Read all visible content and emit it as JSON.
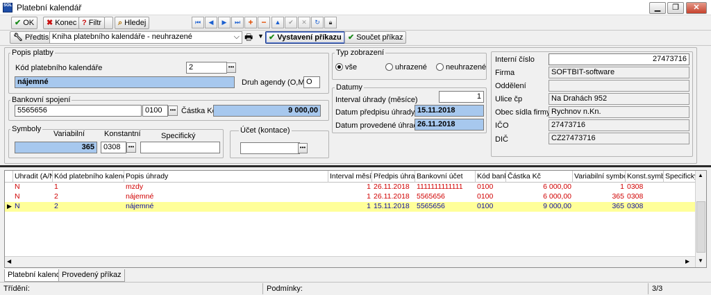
{
  "window": {
    "title": "Platební kalendář",
    "app_icon_text": "SOL"
  },
  "colors": {
    "blue_field": "#a7c8ee",
    "selected_row": "#ffff99",
    "red_text": "#d00000"
  },
  "toolbar": {
    "ok": "OK",
    "konec": "Konec",
    "filtr": "Filtr",
    "hledej": "Hledej",
    "predtisk": "Předtisk",
    "report_select": "Kniha platebního kalendáře - neuhrazené",
    "vystaveni": "Vystavení příkazu",
    "soucet": "Součet příkaz"
  },
  "popis_platby": {
    "legend": "Popis platby",
    "kod_label": "Kód platebního kalendáře",
    "kod_value": "2",
    "nazev_value": "nájemné",
    "druh_label": "Druh agendy (O,M,F)",
    "druh_value": "O"
  },
  "bankovni": {
    "legend": "Bankovní spojení",
    "ucet_value": "5565656",
    "banka_value": "0100",
    "castka_label": "Částka Kč",
    "castka_value": "9 000,00"
  },
  "symboly": {
    "legend": "Symboly",
    "variabilni_label": "Variabilní",
    "konstantni_label": "Konstantní",
    "specificky_label": "Specifický",
    "variabilni_value": "365",
    "konstantni_value": "0308",
    "specificky_value": ""
  },
  "ucet_kontace": {
    "legend": "Účet (kontace)",
    "value": ""
  },
  "typ_zobrazeni": {
    "legend": "Typ zobrazení",
    "options": [
      "vše",
      "uhrazené",
      "neuhrazené"
    ],
    "selected": "vše"
  },
  "datumy": {
    "legend": "Datumy",
    "interval_label": "Interval úhrady (měsíce)",
    "interval_value": "1",
    "predpis_label": "Datum předpisu úhrady",
    "predpis_value": "15.11.2018",
    "provedene_label": "Datum provedené úhrady",
    "provedene_value": "26.11.2018"
  },
  "firma_info": {
    "interni_label": "Interní číslo",
    "interni_value": "27473716",
    "firma_label": "Firma",
    "firma_value": "SOFTBIT-software",
    "oddeleni_label": "Oddělení",
    "oddeleni_value": "",
    "ulice_label": "Ulice čp",
    "ulice_value": "Na Drahách 952",
    "obec_label": "Obec sídla firmy",
    "obec_value": "Rychnov n.Kn.",
    "ico_label": "IČO",
    "ico_value": "27473716",
    "dic_label": "DIČ",
    "dic_value": "CZ27473716"
  },
  "grid": {
    "columns": [
      "Uhradit (A/N)",
      "Kód platebního kalendáře",
      "Popis úhrady",
      "Interval měsíce",
      "Předpis úhrada",
      "Bankovní účet",
      "Kód banky",
      "Částka Kč",
      "Variabilní symbol",
      "Konst.symbol",
      "Specifický"
    ],
    "rows": [
      {
        "uhradit": "N",
        "kod": "1",
        "popis": "mzdy",
        "interval": "1",
        "predpis": "26.11.2018",
        "ucet": "1111111111111",
        "banka": "0100",
        "castka": "6 000,00",
        "vs": "1",
        "ks": "0308",
        "ss": ""
      },
      {
        "uhradit": "N",
        "kod": "2",
        "popis": "nájemné",
        "interval": "1",
        "predpis": "26.11.2018",
        "ucet": "5565656",
        "banka": "0100",
        "castka": "6 000,00",
        "vs": "365",
        "ks": "0308",
        "ss": ""
      },
      {
        "uhradit": "N",
        "kod": "2",
        "popis": "nájemné",
        "interval": "1",
        "predpis": "15.11.2018",
        "ucet": "5565656",
        "banka": "0100",
        "castka": "9 000,00",
        "vs": "365",
        "ks": "0308",
        "ss": ""
      }
    ]
  },
  "tabs": [
    "Platební kalendář",
    "Provedený příkaz"
  ],
  "status": {
    "trideni": "Třídění:",
    "podminky": "Podmínky:",
    "count": "3/3"
  }
}
